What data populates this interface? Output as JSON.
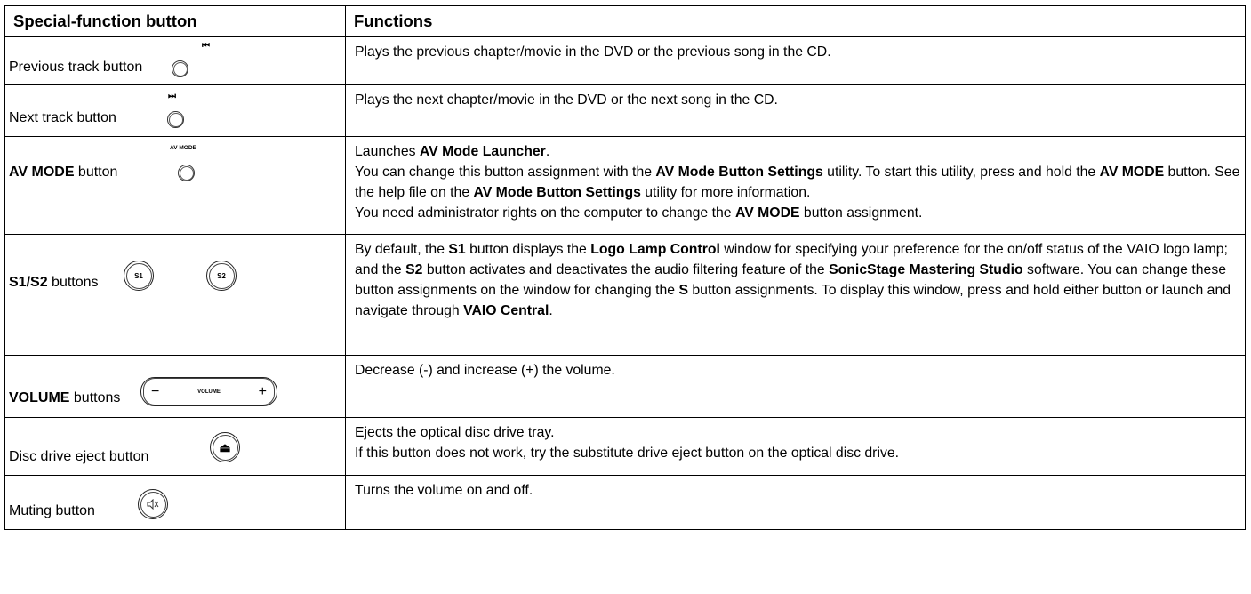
{
  "headers": {
    "col1": "Special-function button",
    "col2": "Functions"
  },
  "rows": {
    "prev": {
      "label": "Previous track button",
      "marking": "⏮",
      "icon": "prev-track-icon",
      "text": "Plays the previous chapter/movie in the DVD or the previous song in the CD."
    },
    "next": {
      "label": "Next track button",
      "marking": "⏭",
      "icon": "next-track-icon",
      "text": "Plays the next chapter/movie in the DVD or the next song in the CD."
    },
    "avmode": {
      "label_bold": "AV MODE",
      "label_rest": " button",
      "marking": "AV MODE",
      "l1_a": "Launches ",
      "l1_b": "AV Mode Launcher",
      "l1_c": ".",
      "l2_a": "You can change this button assignment with the ",
      "l2_b": "AV Mode Button Settings",
      "l2_c": " utility. To start this utility, press and hold the ",
      "l2_d": "AV MODE",
      "l2_e": " button. See the help file on the ",
      "l2_f": "AV Mode Button Settings",
      "l2_g": " utility for more information.",
      "l3_a": "You need administrator rights on the computer to change the ",
      "l3_b": "AV MODE",
      "l3_c": " button assignment."
    },
    "s1s2": {
      "label_bold": "S1/S2",
      "label_rest": " buttons",
      "s1": "S1",
      "s2": "S2",
      "t_a": "By default, the ",
      "t_b": "S1",
      "t_c": " button displays the ",
      "t_d": "Logo Lamp Control",
      "t_e": " window for specifying your preference for the on/off status of the VAIO logo lamp; and the ",
      "t_f": "S2",
      "t_g": " button activates and deactivates the audio filtering feature of the ",
      "t_h": "SonicStage Mastering Studio",
      "t_i": " software. You can change these button assignments on the window for changing the ",
      "t_j": "S",
      "t_k": " button assignments. To display this window, press and hold either button or launch and navigate through ",
      "t_l": "VAIO Central",
      "t_m": "."
    },
    "volume": {
      "label_bold": "VOLUME",
      "label_rest": " buttons",
      "minus": "−",
      "plus": "+",
      "mark": "VOLUME",
      "text": "Decrease (-) and increase (+) the volume."
    },
    "eject": {
      "label": "Disc drive eject button",
      "symbol": "⏏",
      "line1": "Ejects the optical disc drive tray.",
      "line2": "If this button does not work, try the substitute drive eject button on the optical disc drive."
    },
    "mute": {
      "label": "Muting button",
      "icon": "mute-icon",
      "text": "Turns the volume on and off."
    }
  }
}
